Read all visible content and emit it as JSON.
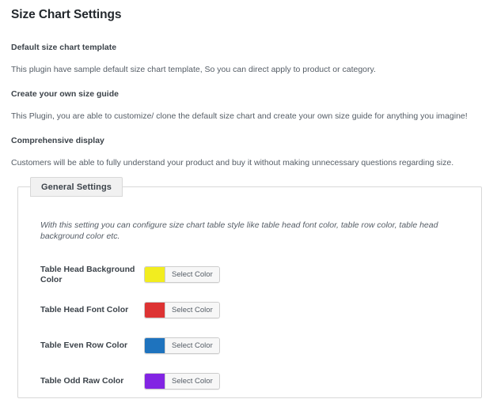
{
  "page": {
    "title": "Size Chart Settings"
  },
  "intro": {
    "features": [
      {
        "heading": "Default size chart template",
        "text": "This plugin have sample default size chart template, So you can direct apply to product or category."
      },
      {
        "heading": "Create your own size guide",
        "text": "This Plugin, you are able to customize/ clone the default size chart and create your own size guide for anything you imagine!"
      },
      {
        "heading": "Comprehensive display",
        "text": "Customers will be able to fully understand your product and buy it without making unnecessary questions regarding size."
      }
    ]
  },
  "panel": {
    "legend": "General Settings",
    "description": "With this setting you can configure size chart table style like table head font color, table row color, table head background color etc.",
    "select_color_label": "Select Color",
    "rows": [
      {
        "label": "Table Head Background Color",
        "color": "#F2ED1F",
        "button_label": "Select Color"
      },
      {
        "label": "Table Head Font Color",
        "color": "#DD3333",
        "button_label": "Select Color"
      },
      {
        "label": "Table Even Row Color",
        "color": "#1E73BE",
        "button_label": "Select Color"
      },
      {
        "label": "Table Odd Raw Color",
        "color": "#8224E3",
        "button_label": "Select Color"
      }
    ]
  }
}
